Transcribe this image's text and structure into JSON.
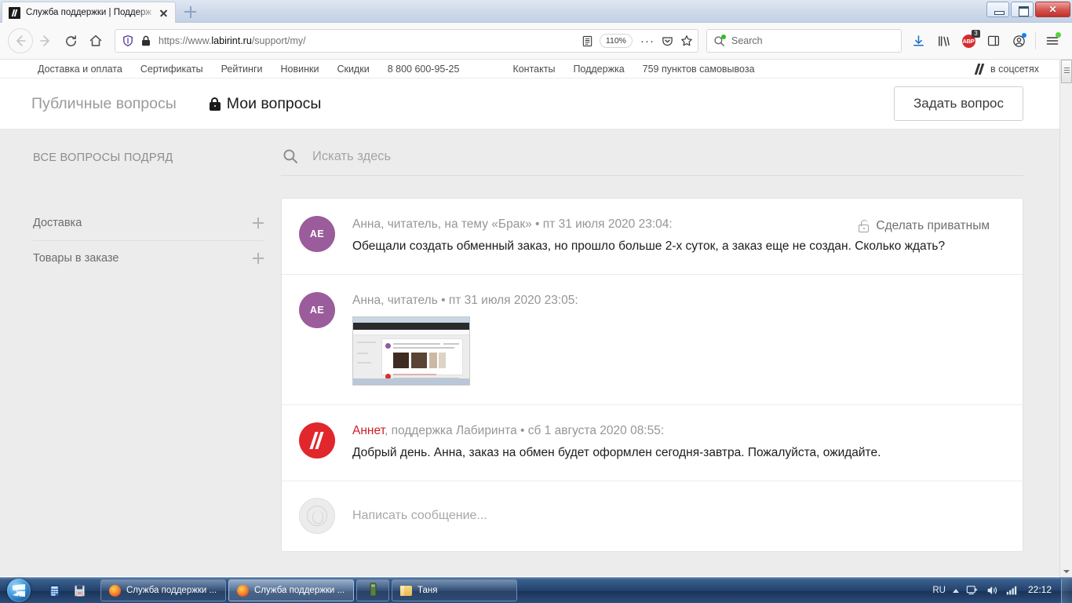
{
  "browser": {
    "tab": {
      "title": "Служба поддержки | Поддерж",
      "favicon": "labirint-favicon"
    },
    "newtab_tooltip": "+",
    "window_controls": {
      "minimize": "minimize-icon",
      "maximize": "maximize-icon",
      "close": "✕"
    },
    "nav": {
      "back": "back-arrow-icon",
      "forward": "forward-arrow-icon",
      "reload": "reload-icon",
      "home": "home-icon"
    },
    "url": {
      "scheme": "https://www.",
      "host": "labirint.ru",
      "path": "/support/my/"
    },
    "zoom_level": "110%",
    "search": {
      "placeholder": "Search"
    },
    "toolbar": {
      "reader": "reader-view-icon",
      "more": "more-actions-icon",
      "pocket": "pocket-icon",
      "bookmark": "bookmark-star-icon",
      "downloads": "downloads-icon",
      "library": "library-icon",
      "adblock": "ABP",
      "adblock_badge": "3",
      "sidebar": "sidebar-icon",
      "account": "account-icon",
      "menu": "hamburger-menu-icon"
    }
  },
  "site": {
    "nav_left": [
      {
        "label": "Доставка и оплата"
      },
      {
        "label": "Сертификаты"
      },
      {
        "label": "Рейтинги"
      },
      {
        "label": "Новинки"
      },
      {
        "label": "Скидки"
      },
      {
        "label": "8 800 600-95-25"
      }
    ],
    "nav_right": [
      {
        "label": "Контакты"
      },
      {
        "label": "Поддержка"
      },
      {
        "label": "759 пунктов самовывоза"
      }
    ],
    "social_label": "в соцсетях",
    "tabs": [
      {
        "label": "Публичные вопросы",
        "active": false,
        "icon": null
      },
      {
        "label": "Мои вопросы",
        "active": true,
        "icon": "lock-icon"
      }
    ],
    "ask_button": "Задать вопрос",
    "sidebar": {
      "title": "ВСЕ ВОПРОСЫ ПОДРЯД",
      "items": [
        {
          "label": "Доставка",
          "expander": "+"
        },
        {
          "label": "Товары в заказе",
          "expander": "+"
        }
      ]
    },
    "search": {
      "placeholder": "Искать здесь",
      "icon": "search-icon"
    },
    "messages": [
      {
        "avatar_initials": "АЕ",
        "avatar_color": "#9b5c9b",
        "avatar_type": "initials",
        "meta": "Анна, читатель, на тему «Брак» • пт 31 июля 2020 23:04:",
        "text": "Обещали создать обменный заказ, но прошло больше 2-х суток, а заказ еще не создан. Сколько ждать?",
        "privacy_action": "Сделать приватным",
        "privacy_icon": "unlocked-padlock-icon"
      },
      {
        "avatar_initials": "АЕ",
        "avatar_color": "#9b5c9b",
        "avatar_type": "initials",
        "meta": "Анна, читатель • пт 31 июля 2020 23:05:",
        "text": "",
        "attachment": "screenshot-thumbnail"
      },
      {
        "avatar_initials": "",
        "avatar_color": "#e1262c",
        "avatar_type": "logo",
        "author": "Аннет",
        "author_color": "#cb2027",
        "meta": ", поддержка Лабиринта • сб 1 августа 2020 08:55:",
        "text": "Добрый день. Анна, заказ на обмен будет оформлен сегодня-завтра. Пожалуйста, ожидайте."
      }
    ],
    "compose": {
      "placeholder": "Написать сообщение...",
      "avatar": "anonymous-avatar-icon"
    }
  },
  "taskbar": {
    "start": "windows-start-orb",
    "quick_launch": [
      {
        "name": "calculator-icon"
      },
      {
        "name": "save-disk-icon"
      }
    ],
    "items": [
      {
        "label": "Служба поддержки ...",
        "icon": "firefox-icon",
        "active": false
      },
      {
        "label": "Служба поддержки ...",
        "icon": "firefox-icon",
        "active": true
      },
      {
        "label": "",
        "icon": "app-icon",
        "active": false
      },
      {
        "label": "Таня",
        "icon": "folder-icon",
        "active": false
      }
    ],
    "tray": {
      "language": "RU",
      "overflow": "show-hidden-icons-arrow",
      "network": "network-icon",
      "volume": "volume-icon",
      "signal": "signal-bars-icon",
      "clock": "22:12"
    }
  }
}
